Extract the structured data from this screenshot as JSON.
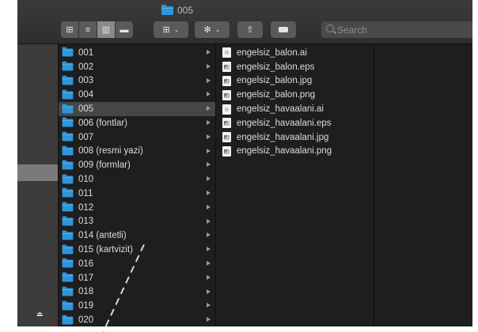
{
  "window": {
    "title": "005"
  },
  "toolbar": {
    "search_placeholder": "Search"
  },
  "folders": [
    {
      "label": "001"
    },
    {
      "label": "002"
    },
    {
      "label": "003"
    },
    {
      "label": "004"
    },
    {
      "label": "005",
      "selected": true
    },
    {
      "label": "006 (fontlar)"
    },
    {
      "label": "007"
    },
    {
      "label": "008 (resmi yazi)"
    },
    {
      "label": "009 (formlar)"
    },
    {
      "label": "010"
    },
    {
      "label": "011"
    },
    {
      "label": "012"
    },
    {
      "label": "013"
    },
    {
      "label": "014 (antetli)"
    },
    {
      "label": "015 (kartvizit)"
    },
    {
      "label": "016"
    },
    {
      "label": "017"
    },
    {
      "label": "018"
    },
    {
      "label": "019"
    },
    {
      "label": "020"
    }
  ],
  "files": [
    {
      "name": "engelsiz_balon.ai",
      "icon": "ai-file-icon"
    },
    {
      "name": "engelsiz_balon.eps",
      "icon": "eps-file-icon"
    },
    {
      "name": "engelsiz_balon.jpg",
      "icon": "image-file-icon"
    },
    {
      "name": "engelsiz_balon.png",
      "icon": "image-file-icon"
    },
    {
      "name": "engelsiz_havaalani.ai",
      "icon": "ai-file-icon"
    },
    {
      "name": "engelsiz_havaalani.eps",
      "icon": "eps-file-icon"
    },
    {
      "name": "engelsiz_havaalani.jpg",
      "icon": "image-file-icon"
    },
    {
      "name": "engelsiz_havaalani.png",
      "icon": "image-file-icon"
    }
  ],
  "colors": {
    "folder": "#2f95d9",
    "background": "#1e1e1e",
    "selection": "#464646"
  }
}
